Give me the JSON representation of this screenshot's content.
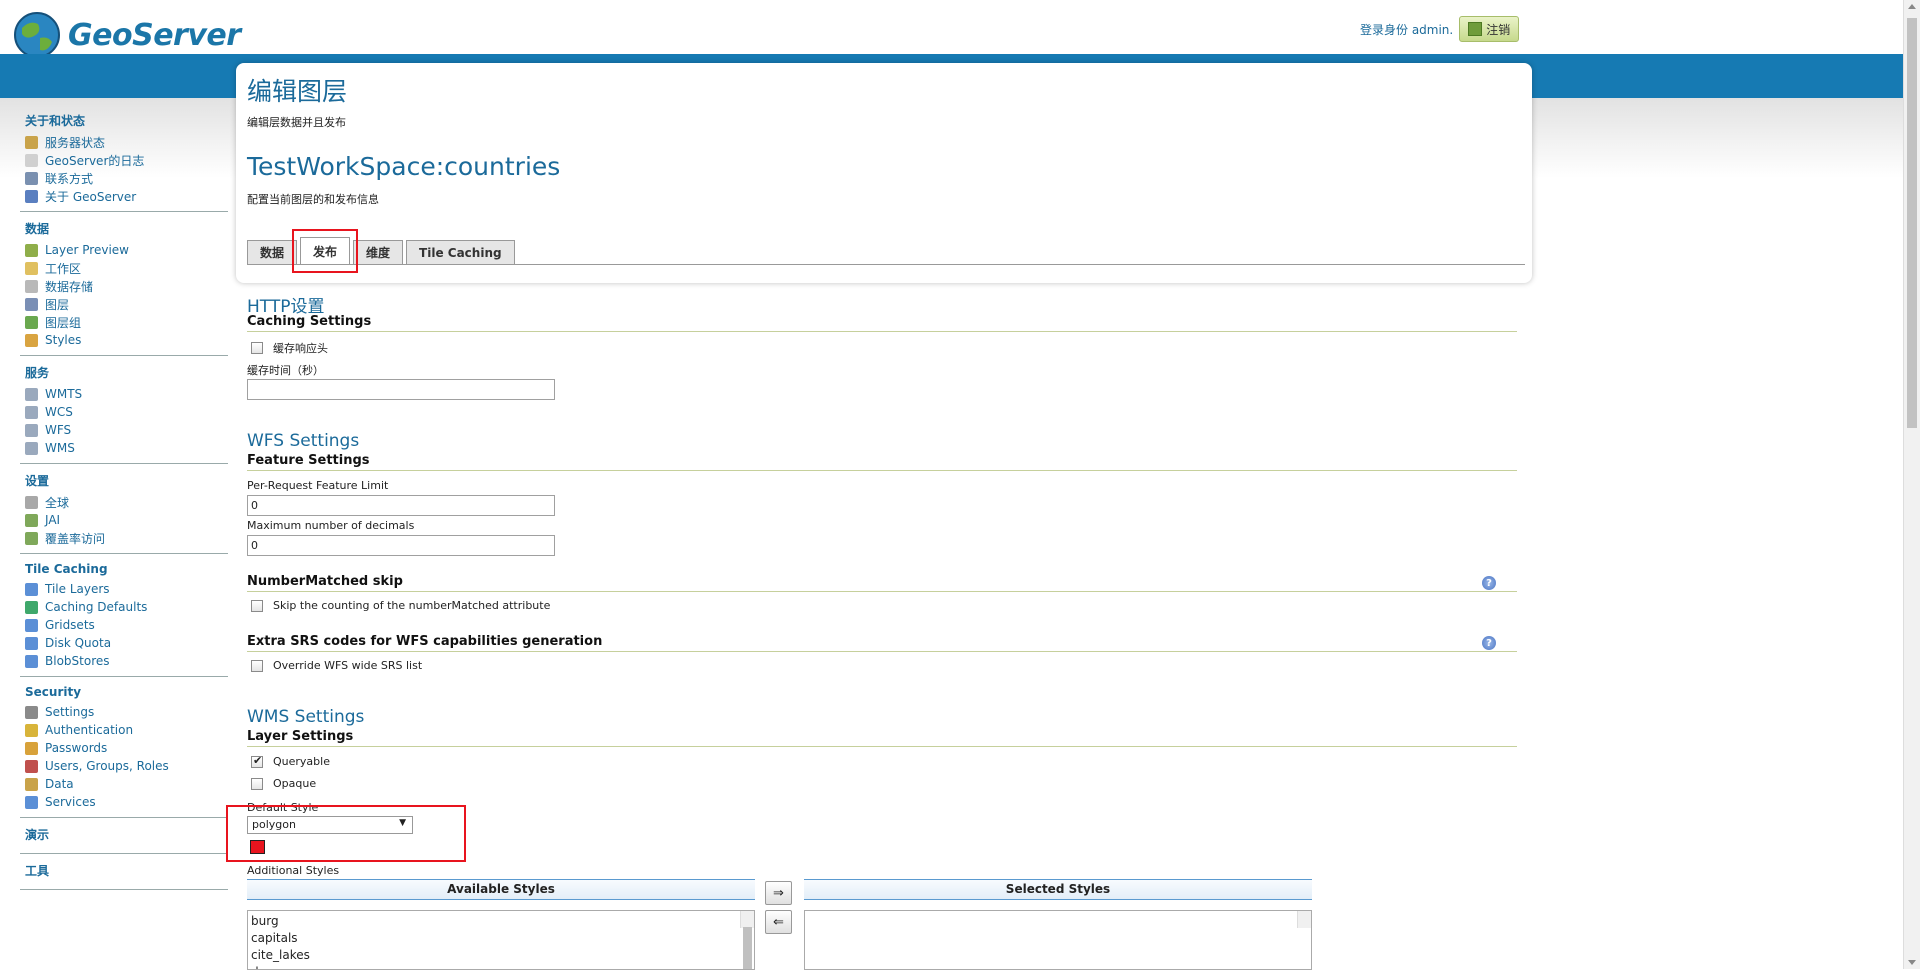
{
  "header": {
    "logo_text": "GeoServer",
    "login_text": "登录身份 admin.",
    "logout_label": "注销"
  },
  "sidebar": {
    "groups": [
      {
        "title": "关于和状态",
        "items": [
          {
            "label": "服务器状态",
            "icon": "server-status-icon"
          },
          {
            "label": "GeoServer的日志",
            "icon": "log-icon"
          },
          {
            "label": "联系方式",
            "icon": "contact-icon"
          },
          {
            "label": "关于 GeoServer",
            "icon": "about-icon"
          }
        ]
      },
      {
        "title": "数据",
        "items": [
          {
            "label": "Layer Preview",
            "icon": "layer-preview-icon"
          },
          {
            "label": "工作区",
            "icon": "workspace-icon"
          },
          {
            "label": "数据存储",
            "icon": "datastore-icon"
          },
          {
            "label": "图层",
            "icon": "layer-icon"
          },
          {
            "label": "图层组",
            "icon": "layergroup-icon"
          },
          {
            "label": "Styles",
            "icon": "styles-icon"
          }
        ]
      },
      {
        "title": "服务",
        "items": [
          {
            "label": "WMTS",
            "icon": "service-icon"
          },
          {
            "label": "WCS",
            "icon": "service-icon"
          },
          {
            "label": "WFS",
            "icon": "service-icon"
          },
          {
            "label": "WMS",
            "icon": "service-icon"
          }
        ]
      },
      {
        "title": "设置",
        "items": [
          {
            "label": "全球",
            "icon": "global-icon"
          },
          {
            "label": "JAI",
            "icon": "jai-icon"
          },
          {
            "label": "覆盖率访问",
            "icon": "coverage-icon"
          }
        ]
      },
      {
        "title": "Tile Caching",
        "items": [
          {
            "label": "Tile Layers",
            "icon": "tile-layers-icon"
          },
          {
            "label": "Caching Defaults",
            "icon": "caching-defaults-icon"
          },
          {
            "label": "Gridsets",
            "icon": "gridsets-icon"
          },
          {
            "label": "Disk Quota",
            "icon": "disk-quota-icon"
          },
          {
            "label": "BlobStores",
            "icon": "blobstores-icon"
          }
        ]
      },
      {
        "title": "Security",
        "items": [
          {
            "label": "Settings",
            "icon": "settings-icon"
          },
          {
            "label": "Authentication",
            "icon": "authentication-icon"
          },
          {
            "label": "Passwords",
            "icon": "passwords-icon"
          },
          {
            "label": "Users, Groups, Roles",
            "icon": "users-icon"
          },
          {
            "label": "Data",
            "icon": "data-security-icon"
          },
          {
            "label": "Services",
            "icon": "services-security-icon"
          }
        ]
      },
      {
        "title": "演示",
        "items": []
      },
      {
        "title": "工具",
        "items": []
      }
    ]
  },
  "main": {
    "page_title": "编辑图层",
    "page_subtitle": "编辑层数据并且发布",
    "layer_title": "TestWorkSpace:countries",
    "layer_subtitle": "配置当前图层的和发布信息",
    "tabs": [
      "数据",
      "发布",
      "维度",
      "Tile Caching"
    ],
    "active_tab": "发布",
    "http": {
      "heading": "HTTP设置",
      "sub": "Caching Settings",
      "cache_headers_label": "缓存响应头",
      "cache_time_label": "缓存时间（秒）",
      "cache_time_value": ""
    },
    "wfs": {
      "heading": "WFS Settings",
      "sub": "Feature Settings",
      "feature_limit_label": "Per-Request Feature Limit",
      "feature_limit_value": "0",
      "decimals_label": "Maximum number of decimals",
      "decimals_value": "0",
      "number_matched_title": "NumberMatched skip",
      "number_matched_label": "Skip the counting of the numberMatched attribute",
      "extra_srs_title": "Extra SRS codes for WFS capabilities generation",
      "extra_srs_label": "Override WFS wide SRS list"
    },
    "wms": {
      "heading": "WMS Settings",
      "sub": "Layer Settings",
      "queryable_label": "Queryable",
      "opaque_label": "Opaque",
      "default_style_label": "Default Style",
      "default_style_value": "polygon",
      "additional_styles_label": "Additional Styles",
      "available_header": "Available Styles",
      "selected_header": "Selected Styles",
      "available_styles": [
        "burg",
        "capitals",
        "cite_lakes",
        "dem"
      ],
      "add_btn": "⇒",
      "remove_btn": "⇐"
    }
  },
  "colors": {
    "banner": "#167ab3",
    "link": "#1b6a9a",
    "highlight": "#e8141e"
  }
}
